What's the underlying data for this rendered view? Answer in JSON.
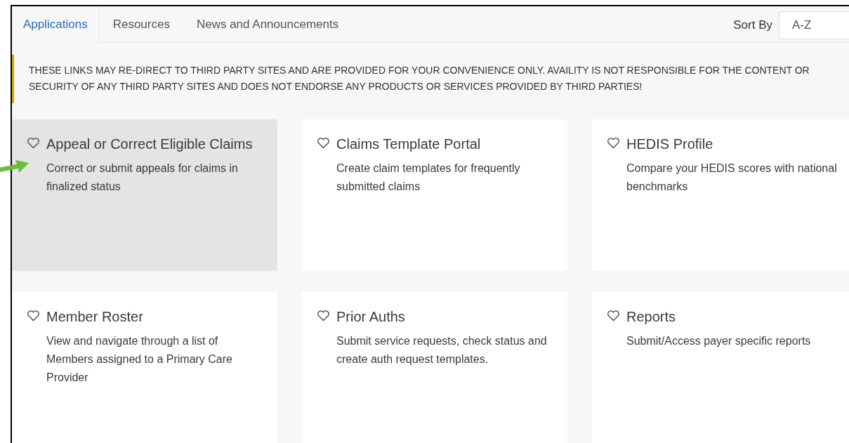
{
  "tabs": [
    {
      "label": "Applications",
      "selected": true
    },
    {
      "label": "Resources",
      "selected": false
    },
    {
      "label": "News and Announcements",
      "selected": false
    }
  ],
  "sort": {
    "label": "Sort By",
    "value": "A-Z"
  },
  "notice": "THESE LINKS MAY RE-DIRECT TO THIRD PARTY SITES AND ARE PROVIDED FOR YOUR CONVENIENCE ONLY. AVAILITY IS NOT RESPONSIBLE FOR THE CONTENT OR SECURITY OF ANY THIRD PARTY SITES AND DOES NOT ENDORSE ANY PRODUCTS OR SERVICES PROVIDED BY THIRD PARTIES!",
  "cards": [
    {
      "title": "Appeal or Correct Eligible Claims",
      "description": "Correct or submit appeals for claims in finalized status",
      "highlighted": true
    },
    {
      "title": "Claims Template Portal",
      "description": "Create claim templates for frequently submitted claims",
      "highlighted": false
    },
    {
      "title": "HEDIS Profile",
      "description": "Compare your HEDIS scores with national benchmarks",
      "highlighted": false
    },
    {
      "title": "Member Roster",
      "description": "View and navigate through a list of Members assigned to a Primary Care Provider",
      "highlighted": false
    },
    {
      "title": "Prior Auths",
      "description": "Submit service requests, check status and create auth request templates.",
      "highlighted": false
    },
    {
      "title": "Reports",
      "description": "Submit/Access payer specific reports",
      "highlighted": false
    }
  ]
}
